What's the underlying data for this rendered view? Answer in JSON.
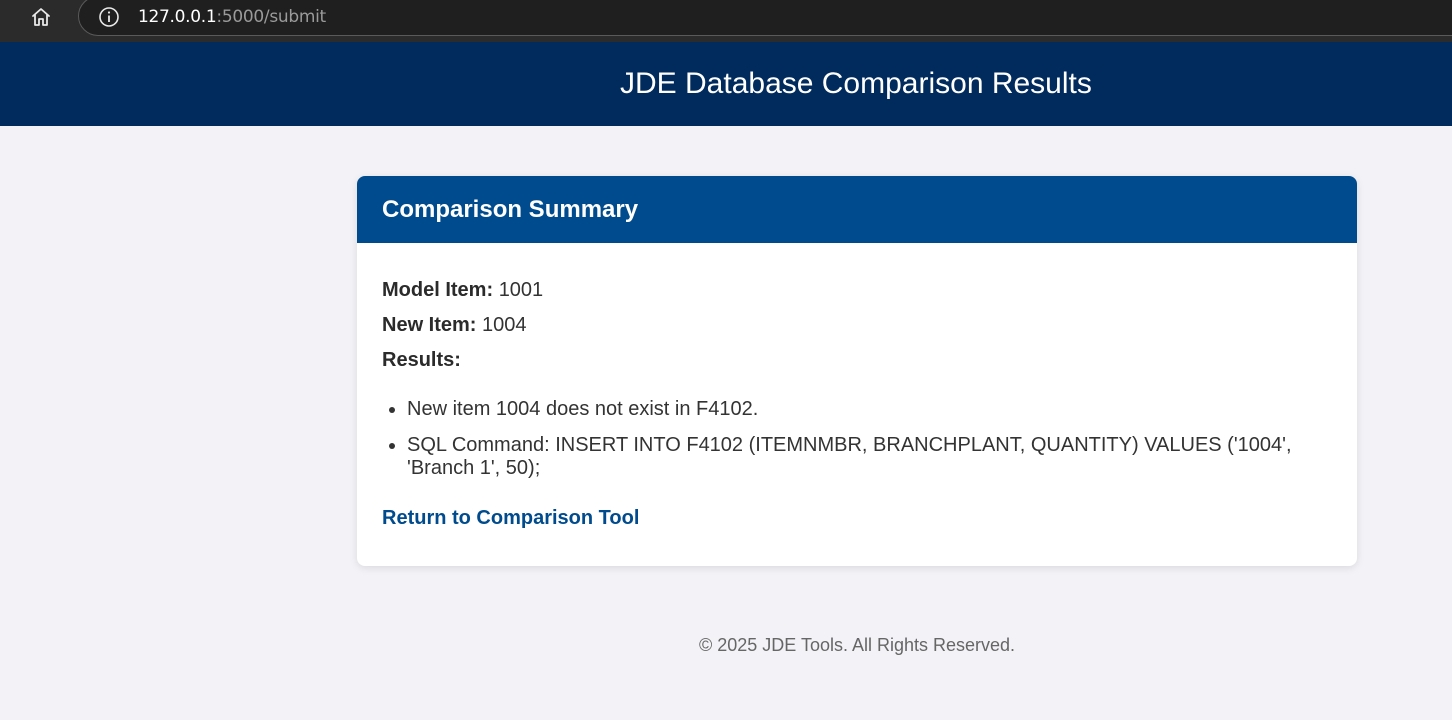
{
  "browser": {
    "url_host": "127.0.0.1",
    "url_path": ":5000/submit",
    "home_icon": "home-icon",
    "info_icon": "info-icon"
  },
  "header": {
    "title": "JDE Database Comparison Results"
  },
  "card": {
    "title": "Comparison Summary",
    "model_item_label": "Model Item:",
    "model_item_value": "1001",
    "new_item_label": "New Item:",
    "new_item_value": "1004",
    "results_label": "Results:",
    "results": [
      "New item 1004 does not exist in F4102.",
      "SQL Command: INSERT INTO F4102 (ITEMNMBR, BRANCHPLANT, QUANTITY) VALUES ('1004', 'Branch 1', 50);"
    ],
    "return_link": "Return to Comparison Tool"
  },
  "footer": {
    "text": "© 2025 JDE Tools. All Rights Reserved."
  },
  "colors": {
    "header_bg": "#002b5c",
    "card_header_bg": "#004b8d",
    "link": "#004b8d",
    "page_bg": "#f3f3f7"
  }
}
